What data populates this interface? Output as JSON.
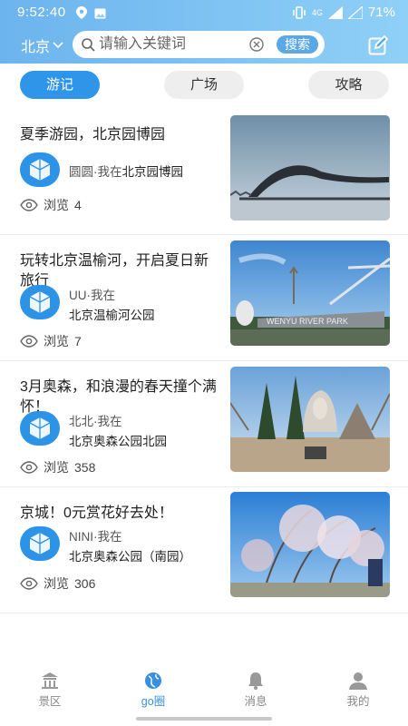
{
  "status": {
    "time": "9:52:40",
    "network": "4G",
    "battery": "71%"
  },
  "header": {
    "city": "北京",
    "search_placeholder": "请输入关键词",
    "search_button": "搜索"
  },
  "tabs": [
    {
      "label": "游记",
      "active": true
    },
    {
      "label": "广场",
      "active": false
    },
    {
      "label": "攻略",
      "active": false
    }
  ],
  "cards": [
    {
      "title": "夏季游园，北京园博园",
      "user_prefix": "圆圆·我在",
      "location": "北京园博园",
      "views_label": "浏览",
      "views": "4"
    },
    {
      "title": "玩转北京温榆河，开启夏日新旅行",
      "user_prefix": "UU·我在",
      "location": "北京温榆河公园",
      "views_label": "浏览",
      "views": "7"
    },
    {
      "title": "3月奥森，和浪漫的春天撞个满怀！",
      "user_prefix": "北北·我在",
      "location": "北京奥森公园北园",
      "views_label": "浏览",
      "views": "358"
    },
    {
      "title": "京城！0元赏花好去处！",
      "user_prefix": "NINI·我在",
      "location": "北京奥森公园（南园）",
      "views_label": "浏览",
      "views": "306"
    }
  ],
  "nav": [
    {
      "label": "景区",
      "icon": "temple-icon",
      "active": false
    },
    {
      "label": "go圈",
      "icon": "globe-icon",
      "active": true
    },
    {
      "label": "消息",
      "icon": "bell-icon",
      "active": false
    },
    {
      "label": "我的",
      "icon": "person-icon",
      "active": false
    }
  ],
  "colors": {
    "accent": "#2f95e8",
    "header_start": "#6cb4ee",
    "header_end": "#8fd0f7"
  }
}
